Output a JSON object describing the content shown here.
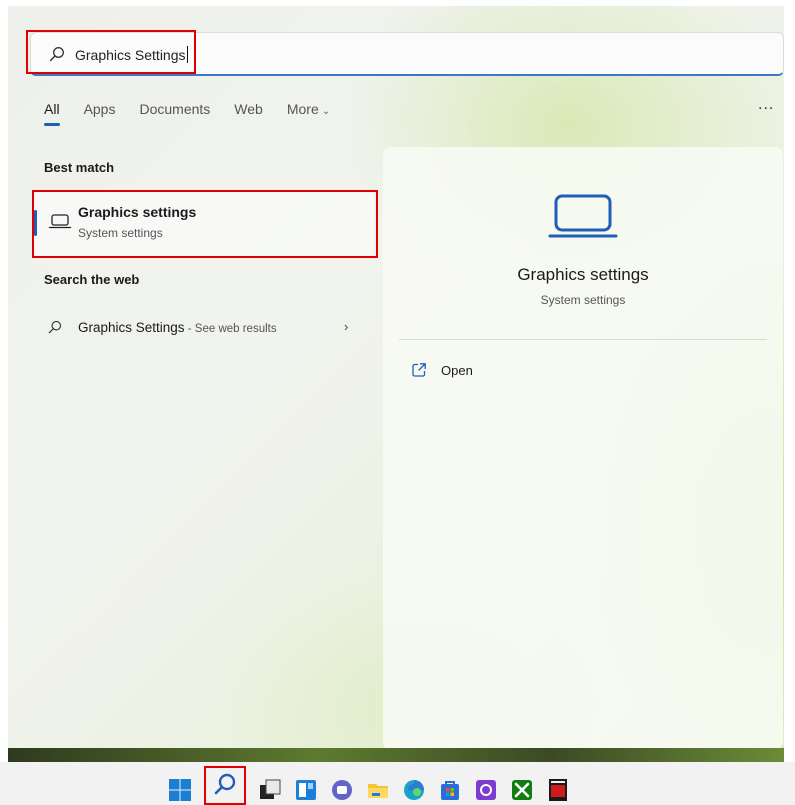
{
  "search": {
    "query": "Graphics Settings",
    "icon": "search-icon"
  },
  "tabs": [
    {
      "label": "All",
      "active": true
    },
    {
      "label": "Apps"
    },
    {
      "label": "Documents"
    },
    {
      "label": "Web"
    },
    {
      "label": "More",
      "chevron": "chevron-down-icon"
    }
  ],
  "more_options": "...",
  "best_match": {
    "heading": "Best match",
    "title": "Graphics settings",
    "subtitle": "System settings",
    "icon": "laptop-icon"
  },
  "web": {
    "heading": "Search the web",
    "query": "Graphics Settings",
    "hint": " - See web results",
    "icon": "search-icon",
    "arrow": "chevron-right-icon"
  },
  "detail": {
    "title": "Graphics settings",
    "subtitle": "System settings",
    "icon": "laptop-icon",
    "actions": [
      {
        "label": "Open",
        "icon": "open-external-icon"
      }
    ]
  },
  "taskbar": {
    "items": [
      {
        "name": "windows-start-icon"
      },
      {
        "name": "search-icon",
        "highlighted": true
      },
      {
        "name": "task-view-icon"
      },
      {
        "name": "widgets-icon"
      },
      {
        "name": "teams-chat-icon"
      },
      {
        "name": "file-explorer-icon"
      },
      {
        "name": "edge-browser-icon"
      },
      {
        "name": "microsoft-store-icon"
      },
      {
        "name": "purple-app-icon"
      },
      {
        "name": "xbox-icon"
      },
      {
        "name": "red-app-icon"
      }
    ]
  },
  "colors": {
    "accent": "#1f5fb8",
    "highlight_box": "#e10000"
  }
}
